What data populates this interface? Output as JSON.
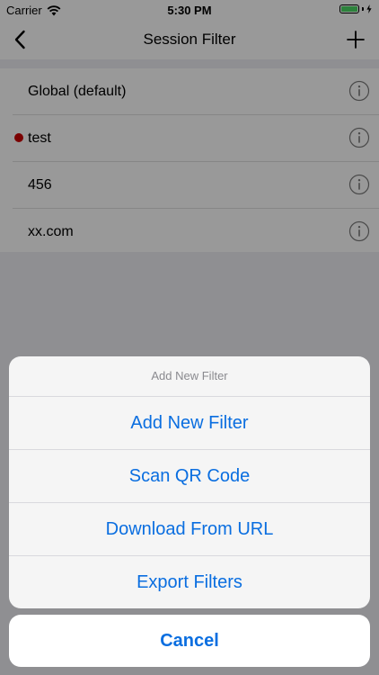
{
  "status_bar": {
    "carrier": "Carrier",
    "time": "5:30 PM",
    "battery_level": 1.0
  },
  "nav_bar": {
    "title": "Session Filter"
  },
  "filters": [
    {
      "name": "Global (default)",
      "active": false
    },
    {
      "name": "test",
      "active": true
    },
    {
      "name": "456",
      "active": false
    },
    {
      "name": "xx.com",
      "active": false
    }
  ],
  "action_sheet": {
    "title": "Add New Filter",
    "actions": [
      "Add New Filter",
      "Scan QR Code",
      "Download From URL",
      "Export Filters"
    ],
    "cancel": "Cancel"
  },
  "colors": {
    "tint": "#0a6ee0",
    "active_dot": "#cc0000",
    "battery": "#4cd964"
  }
}
